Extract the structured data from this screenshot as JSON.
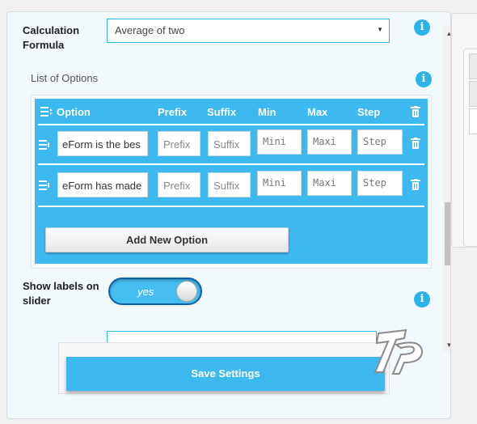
{
  "calculation_formula": {
    "label": "Calculation Formula",
    "selected": "Average of two"
  },
  "options": {
    "section_title": "List of Options",
    "columns": {
      "option": "Option",
      "prefix": "Prefix",
      "suffix": "Suffix",
      "min": "Min",
      "max": "Max",
      "step": "Step"
    },
    "rows": [
      {
        "option": "eForm is the bes",
        "prefix": "Prefix",
        "suffix": "Suffix",
        "min": "Mini",
        "max": "Maxi",
        "step": "Step"
      },
      {
        "option": "eForm has made",
        "prefix": "Prefix",
        "suffix": "Suffix",
        "min": "Mini",
        "max": "Maxi",
        "step": "Step"
      }
    ],
    "add_label": "Add New Option"
  },
  "slider_labels": {
    "label": "Show labels on slider",
    "toggle_text": "yes"
  },
  "save_label": "Save Settings",
  "colors": {
    "accent": "#3db9f0",
    "toggle_border": "#0e5fa3"
  },
  "icons": {
    "info": "info-icon",
    "trash": "trash-icon",
    "drag": "drag-handle-icon",
    "caret": "caret-down-icon"
  }
}
